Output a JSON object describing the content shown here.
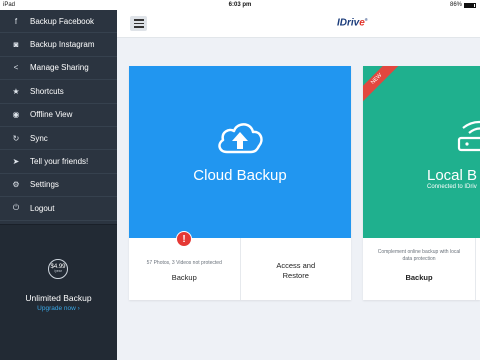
{
  "status_bar": {
    "carrier": "iPad",
    "time": "6:03 pm",
    "battery": "86%"
  },
  "sidebar": {
    "items": [
      {
        "label": "Backup Facebook",
        "icon": "facebook-icon"
      },
      {
        "label": "Backup Instagram",
        "icon": "instagram-icon"
      },
      {
        "label": "Manage Sharing",
        "icon": "share-icon"
      },
      {
        "label": "Shortcuts",
        "icon": "star-icon"
      },
      {
        "label": "Offline View",
        "icon": "eye-icon"
      },
      {
        "label": "Sync",
        "icon": "sync-icon"
      },
      {
        "label": "Tell your friends!",
        "icon": "send-icon"
      },
      {
        "label": "Settings",
        "icon": "gear-icon"
      },
      {
        "label": "Logout",
        "icon": "power-icon"
      }
    ],
    "promo": {
      "price": "$4.99",
      "period": "/year",
      "title": "Unlimited Backup",
      "link": "Upgrade now ›"
    }
  },
  "header": {
    "logo_main": "IDriv",
    "logo_accent": "e",
    "logo_mark": "®"
  },
  "cloud_card": {
    "title": "Cloud Backup",
    "alert": "!",
    "backup_status": "57 Photos, 3 Videos not protected",
    "backup_label": "Backup",
    "access_label": "Access and Restore"
  },
  "local_card": {
    "ribbon": "NEW",
    "title": "Local B",
    "subtitle": "Connected to IDriv",
    "description": "Complement online backup with local data protection",
    "backup_label": "Backup"
  },
  "colors": {
    "sidebar": "#2b3440",
    "cloud": "#2196f0",
    "local": "#1fb08e",
    "ribbon": "#e2473f",
    "link": "#39a7e6"
  }
}
